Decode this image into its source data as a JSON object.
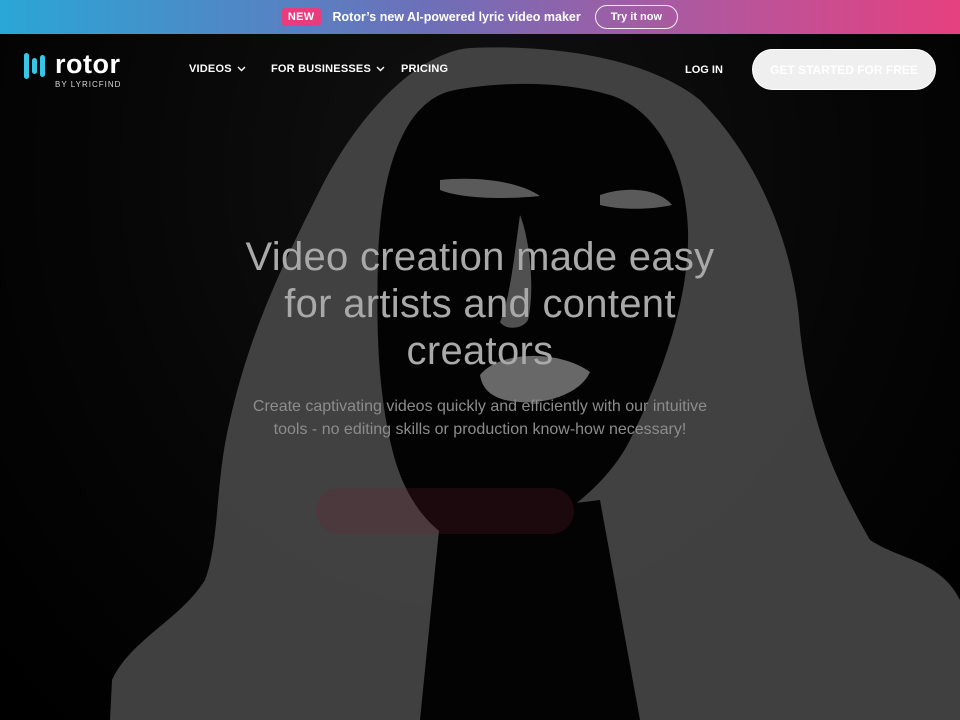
{
  "announcement": {
    "badge": "NEW",
    "text": "Rotor’s new AI-powered lyric video maker",
    "button": "Try it now"
  },
  "brand": {
    "name": "rotor",
    "tagline": "BY LYRICFIND",
    "accent_color": "#38c6e6"
  },
  "nav": {
    "items": [
      {
        "label": "VIDEOS",
        "icon": "chevron-down-icon"
      },
      {
        "label": "FOR BUSINESSES",
        "icon": "chevron-down-icon"
      },
      {
        "label": "PRICING"
      }
    ],
    "login": "LOG IN",
    "cta": "GET STARTED FOR FREE"
  },
  "hero": {
    "headline_lines": [
      "Video creation made easy",
      "for artists and content",
      "creators"
    ],
    "subtext_lines": [
      "Create captivating videos quickly and efficiently with our intuitive",
      "tools - no editing skills or production know-how necessary!"
    ]
  },
  "colors": {
    "gradient_start": "#2aa6d6",
    "gradient_end": "#e6407f",
    "badge": "#e93b7d"
  }
}
